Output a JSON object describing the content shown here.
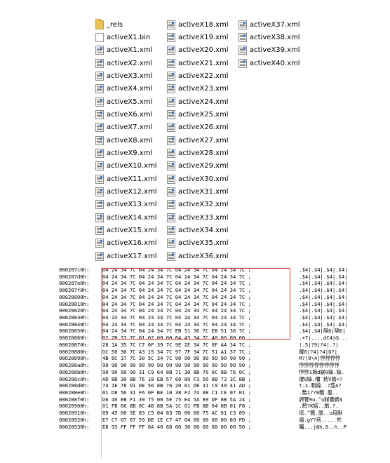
{
  "explorer": {
    "columns": [
      [
        {
          "name": "_rels",
          "icon": "folder-icon"
        },
        {
          "name": "activeX1.bin",
          "icon": "bin-file-icon"
        },
        {
          "name": "activeX1.xml",
          "icon": "xml-file-icon"
        },
        {
          "name": "activeX2.xml",
          "icon": "xml-file-icon"
        },
        {
          "name": "activeX3.xml",
          "icon": "xml-file-icon"
        },
        {
          "name": "activeX4.xml",
          "icon": "xml-file-icon"
        },
        {
          "name": "activeX5.xml",
          "icon": "xml-file-icon"
        },
        {
          "name": "activeX6.xml",
          "icon": "xml-file-icon"
        },
        {
          "name": "activeX7.xml",
          "icon": "xml-file-icon"
        },
        {
          "name": "activeX8.xml",
          "icon": "xml-file-icon"
        },
        {
          "name": "activeX9.xml",
          "icon": "xml-file-icon"
        },
        {
          "name": "activeX10.xml",
          "icon": "xml-file-icon"
        },
        {
          "name": "activeX11.xml",
          "icon": "xml-file-icon"
        },
        {
          "name": "activeX12.xml",
          "icon": "xml-file-icon"
        },
        {
          "name": "activeX13.xml",
          "icon": "xml-file-icon"
        },
        {
          "name": "activeX14.xml",
          "icon": "xml-file-icon"
        },
        {
          "name": "activeX15.xml",
          "icon": "xml-file-icon"
        },
        {
          "name": "activeX16.xml",
          "icon": "xml-file-icon"
        },
        {
          "name": "activeX17.xml",
          "icon": "xml-file-icon"
        }
      ],
      [
        {
          "name": "activeX18.xml",
          "icon": "xml-file-icon"
        },
        {
          "name": "activeX19.xml",
          "icon": "xml-file-icon"
        },
        {
          "name": "activeX20.xml",
          "icon": "xml-file-icon"
        },
        {
          "name": "activeX21.xml",
          "icon": "xml-file-icon"
        },
        {
          "name": "activeX22.xml",
          "icon": "xml-file-icon"
        },
        {
          "name": "activeX23.xml",
          "icon": "xml-file-icon"
        },
        {
          "name": "activeX24.xml",
          "icon": "xml-file-icon"
        },
        {
          "name": "activeX25.xml",
          "icon": "xml-file-icon"
        },
        {
          "name": "activeX26.xml",
          "icon": "xml-file-icon"
        },
        {
          "name": "activeX27.xml",
          "icon": "xml-file-icon"
        },
        {
          "name": "activeX28.xml",
          "icon": "xml-file-icon"
        },
        {
          "name": "activeX29.xml",
          "icon": "xml-file-icon"
        },
        {
          "name": "activeX30.xml",
          "icon": "xml-file-icon"
        },
        {
          "name": "activeX31.xml",
          "icon": "xml-file-icon"
        },
        {
          "name": "activeX32.xml",
          "icon": "xml-file-icon"
        },
        {
          "name": "activeX33.xml",
          "icon": "xml-file-icon"
        },
        {
          "name": "activeX34.xml",
          "icon": "xml-file-icon"
        },
        {
          "name": "activeX35.xml",
          "icon": "xml-file-icon"
        },
        {
          "name": "activeX36.xml",
          "icon": "xml-file-icon"
        }
      ],
      [
        {
          "name": "activeX37.xml",
          "icon": "xml-file-icon"
        },
        {
          "name": "activeX38.xml",
          "icon": "xml-file-icon"
        },
        {
          "name": "activeX39.xml",
          "icon": "xml-file-icon"
        },
        {
          "name": "activeX40.xml",
          "icon": "xml-file-icon"
        }
      ]
    ]
  },
  "hexview": {
    "rows": [
      {
        "addr": "000207c0h:",
        "hex": "04 24 34 7C 04 24 34 7C 04 24 34 7C 04 24 34 7C ;",
        "ascii": ".$4|.$4|.$4|.$4|"
      },
      {
        "addr": "000207d0h:",
        "hex": "04 24 34 7C 04 24 34 7C 04 24 34 7C 04 24 34 7C ;",
        "ascii": ".$4|.$4|.$4|.$4|"
      },
      {
        "addr": "000207e0h:",
        "hex": "04 24 34 7C 04 24 34 7C 04 24 34 7C 04 24 34 7C ;",
        "ascii": ".$4|.$4|.$4|.$4|"
      },
      {
        "addr": "000207f0h:",
        "hex": "04 24 34 7C 04 24 34 7C 04 24 34 7C 04 24 34 7C ;",
        "ascii": ".$4|.$4|.$4|.$4|"
      },
      {
        "addr": "00020800h:",
        "hex": "04 24 34 7C 04 24 34 7C 04 24 34 7C 04 24 34 7C ;",
        "ascii": ".$4|.$4|.$4|.$4|"
      },
      {
        "addr": "00020810h:",
        "hex": "04 24 34 7C 04 24 34 7C 04 24 34 7C 04 24 34 7C ;",
        "ascii": ".$4|.$4|.$4|.$4|"
      },
      {
        "addr": "00020820h:",
        "hex": "04 24 34 7C 04 24 34 7C 04 24 34 7C 04 24 34 7C ;",
        "ascii": ".$4|.$4|.$4|.$4|"
      },
      {
        "addr": "00020830h:",
        "hex": "04 24 34 7C 04 24 34 7C 04 24 34 7C 04 24 34 7C ;",
        "ascii": ".$4|.$4|.$4|.$4|"
      },
      {
        "addr": "00020840h:",
        "hex": "04 24 34 7C 04 24 34 7C 04 24 34 7C 04 24 34 7C ;",
        "ascii": ".$4|.$4|.$4|.$4|"
      },
      {
        "addr": "00020850h:",
        "hex": "04 24 34 7C 04 24 34 7C EB 51 36 7C EB 51 36 7C ;",
        "ascii": ".$4|.$4|隔6|隔6|"
      },
      {
        "addr": "00020860h:",
        "hex": "02 2B 37 7C 01 02 00 00 64 43 34 7C 40 00 00 00 ;",
        "ascii": ".+7|....dC4|@..."
      },
      {
        "addr": "00020870h:",
        "hex": "28 1A 35 7C C7 0F 39 7C 9E 2E 34 7C 0F A4 34 7C ;",
        "ascii": "(.5|?9|?4|.?|"
      },
      {
        "addr": "00020880h:",
        "hex": "DC 50 36 7C A3 15 34 7C 97 7F 34 7C 51 A1 37 7C ;",
        "ascii": "躍6|?4|?4|Q?|"
      },
      {
        "addr": "00020890h:",
        "hex": "4B 8C 37 7C 30 5C 34 7C 90 90 90 90 90 90 90 90 ;",
        "ascii": "M?|0\\4|悙悙悙悙"
      },
      {
        "addr": "000208a0h:",
        "hex": "90 90 90 90 90 90 90 90 90 90 90 90 90 90 90 90 ;",
        "ascii": "悙悙悙悙悙悙悙悙"
      },
      {
        "addr": "000208b0h:",
        "hex": "90 90 90 90 31 C9 64 8B 71 30 8B 76 0C 8B 76 0C ;",
        "ascii": "悙悙1墒d媞0媣.媣."
      },
      {
        "addr": "000208c0h:",
        "hex": "AD 8B 30 8B 76 18 EB 57 60 89 F3 56 8B 73 3C 8B ;",
        "ascii": "瓔0媣.隬`夡V媠<?"
      },
      {
        "addr": "000208d0h:",
        "hex": "74 1E 78 01 DE 56 8B 76 20 01 DE 31 C9 49 41 AD ;",
        "ascii": "t.x.轛媣 .?蒊A?"
      },
      {
        "addr": "000208e0h:",
        "hex": "01 D8 56 31 F6 0F BE 10 38 F2 74 08 C1 CE 07 01 ;",
        "ascii": ".豓1??8騮.瘟.."
      },
      {
        "addr": "000208f0h:",
        "hex": "D6 40 EB F1 39 75 00 5E 75 E4 5A 89 DF 8B 5A 24 ;",
        "ascii": "諤腎9u.^u銶夁婤$"
      },
      {
        "addr": "00020900h:",
        "hex": "01 FB 66 8B 0C 4B 8B 5A 1C 01 FB 8B 04 8B 01 F8 ;",
        "ascii": ".鹒?K婼..鹚.?."
      },
      {
        "addr": "00020910h:",
        "hex": "89 45 00 5E 83 C5 04 83 7D 00 00 75 AC 61 C3 89 ;",
        "ascii": "塃.^兣.億..u琣脡"
      },
      {
        "addr": "00020920h:",
        "hex": "E7 C7 07 67 59 DE 1E C7 47 04 00 00 00 00 89 FD ;",
        "ascii": "缜.gY?荊.....夗"
      },
      {
        "addr": "00020930h:",
        "hex": "E8 93 FF FF FF 6A 40 68 00 30 00 00 68 00 00 50 ;",
        "ascii": "钃...j@h.0..h..P"
      }
    ]
  },
  "colors": {
    "highlight_border": "#d23a3a",
    "folder": "#e8c35a"
  }
}
